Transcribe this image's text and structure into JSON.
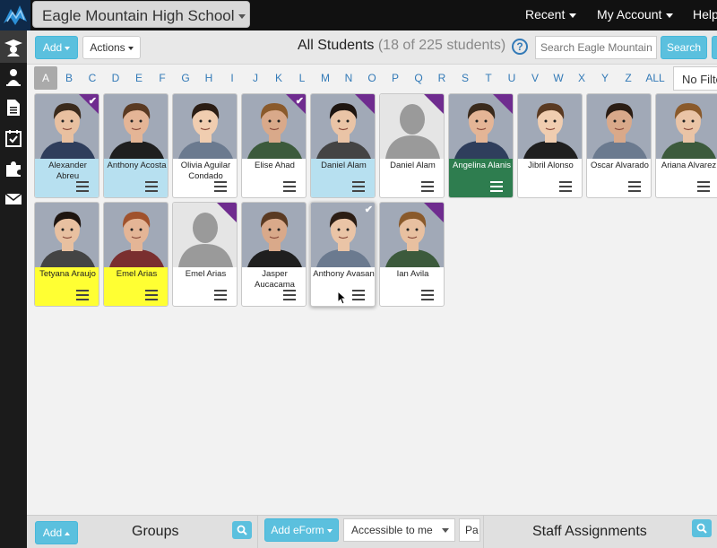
{
  "topbar": {
    "school_name": "Eagle Mountain High School",
    "recent_label": "Recent",
    "account_label": "My Account",
    "help_label": "Help"
  },
  "sidebar": {
    "icons": [
      "graduation-cap-icon",
      "user-icon",
      "document-icon",
      "checklist-icon",
      "puzzle-icon",
      "envelope-icon"
    ]
  },
  "toolbar": {
    "add_label": "Add",
    "actions_label": "Actions",
    "title": "All Students",
    "count": "(18 of 225 students)",
    "help_glyph": "?",
    "search_placeholder": "Search Eagle Mountain",
    "search_label": "Search"
  },
  "letterbar": {
    "letters": [
      "A",
      "B",
      "C",
      "D",
      "E",
      "F",
      "G",
      "H",
      "I",
      "J",
      "K",
      "L",
      "M",
      "N",
      "O",
      "P",
      "Q",
      "R",
      "S",
      "T",
      "U",
      "V",
      "W",
      "X",
      "Y",
      "Z",
      "ALL"
    ],
    "active": "A",
    "filter_label": "No Filter"
  },
  "students": [
    {
      "name": "Alexander Abreu",
      "highlight": "blue",
      "flag": true,
      "checked": true,
      "photo": "real"
    },
    {
      "name": "Anthony Acosta",
      "highlight": "blue",
      "flag": false,
      "checked": false,
      "photo": "real"
    },
    {
      "name": "Olivia Aguilar Condado",
      "highlight": "none",
      "flag": false,
      "checked": false,
      "photo": "real"
    },
    {
      "name": "Elise Ahad",
      "highlight": "none",
      "flag": true,
      "checked": true,
      "photo": "real"
    },
    {
      "name": "Daniel Alam",
      "highlight": "blue",
      "flag": true,
      "checked": false,
      "photo": "real"
    },
    {
      "name": "Daniel Alam",
      "highlight": "none",
      "flag": true,
      "checked": false,
      "photo": "placeholder"
    },
    {
      "name": "Angelina Alanis",
      "highlight": "green",
      "flag": true,
      "checked": false,
      "photo": "real"
    },
    {
      "name": "Jibril Alonso",
      "highlight": "none",
      "flag": false,
      "checked": false,
      "photo": "real"
    },
    {
      "name": "Oscar Alvarado",
      "highlight": "none",
      "flag": false,
      "checked": false,
      "photo": "real"
    },
    {
      "name": "Ariana Alvarez",
      "highlight": "none",
      "flag": false,
      "checked": false,
      "photo": "real"
    },
    {
      "name": "Tetyana Araujo",
      "highlight": "yellow",
      "flag": false,
      "checked": false,
      "photo": "real"
    },
    {
      "name": "Emel Arias",
      "highlight": "yellow",
      "flag": false,
      "checked": false,
      "photo": "real"
    },
    {
      "name": "Emel Arias",
      "highlight": "none",
      "flag": true,
      "checked": false,
      "photo": "placeholder"
    },
    {
      "name": "Jasper Aucacama",
      "highlight": "none",
      "flag": false,
      "checked": false,
      "photo": "real"
    },
    {
      "name": "Anthony Avasan",
      "highlight": "none",
      "flag": false,
      "checked": true,
      "photo": "real"
    },
    {
      "name": "Ian Avila",
      "highlight": "none",
      "flag": true,
      "checked": false,
      "photo": "real"
    }
  ],
  "bottom": {
    "groups_add_label": "Add",
    "groups_title": "Groups",
    "eform_label": "Add eForm",
    "accessible_value": "Accessible to me",
    "third_select_value": "Pa",
    "staff_title": "Staff Assignments"
  },
  "colors": {
    "topbar": "#111111",
    "accent_blue": "#5bc0de",
    "flag_purple": "#6f2c8f",
    "highlight_blue": "#b7e0f0",
    "highlight_green": "#2e7d4f",
    "highlight_yellow": "#ffff33"
  }
}
